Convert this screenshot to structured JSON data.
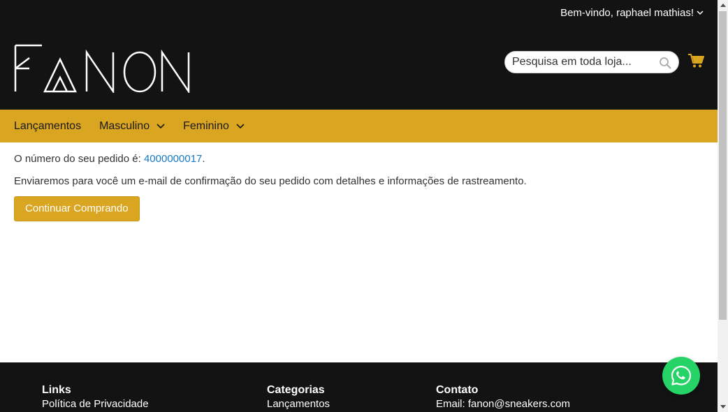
{
  "header": {
    "welcome_text": "Bem-vindo, raphael mathias!",
    "logo_text": "FANON",
    "search_placeholder": "Pesquisa em toda loja..."
  },
  "nav": {
    "items": [
      {
        "label": "Lançamentos",
        "has_dropdown": false
      },
      {
        "label": "Masculino",
        "has_dropdown": true
      },
      {
        "label": "Feminino",
        "has_dropdown": true
      }
    ]
  },
  "main": {
    "order_prefix": "O número do seu pedido é: ",
    "order_number": "4000000017",
    "order_suffix": ".",
    "email_message": "Enviaremos para você um e-mail de confirmação do seu pedido com detalhes e informações de rastreamento.",
    "continue_button": "Continuar Comprando"
  },
  "footer": {
    "links_title": "Links",
    "links_item": "Política de Privacidade",
    "categories_title": "Categorias",
    "categories_item": "Lançamentos",
    "contact_title": "Contato",
    "contact_email": "Email: fanon@sneakers.com"
  },
  "colors": {
    "header_bg": "#131313",
    "accent": "#daa520",
    "link": "#1979c3",
    "whatsapp": "#25d366"
  },
  "icons": {
    "search": "search-icon",
    "cart": "cart-icon",
    "whatsapp": "whatsapp-icon",
    "chevron": "chevron-down-icon"
  }
}
